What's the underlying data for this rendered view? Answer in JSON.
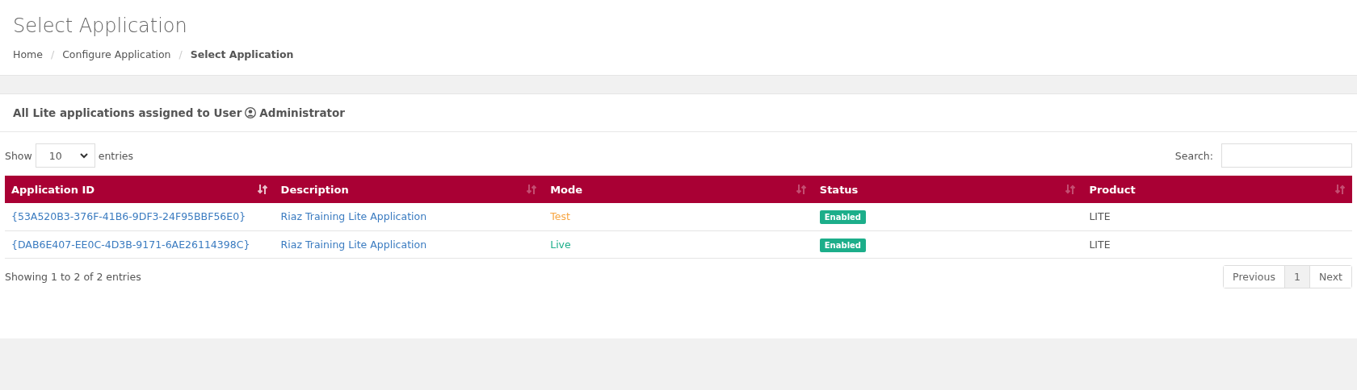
{
  "page_title": "Select Application",
  "breadcrumb": [
    {
      "label": "Home",
      "current": false
    },
    {
      "separator": "/",
      "label": "Configure Application",
      "current": false
    },
    {
      "separator": "/",
      "label": "Select Application",
      "current": true
    }
  ],
  "card": {
    "title_prefix": "All Lite applications assigned to User",
    "user": "Administrator"
  },
  "length_control": {
    "before": "Show",
    "value": "10",
    "after": "entries"
  },
  "search": {
    "label": "Search:"
  },
  "table": {
    "columns": [
      {
        "label": "Application ID",
        "sorted": true
      },
      {
        "label": "Description",
        "sorted": false
      },
      {
        "label": "Mode",
        "sorted": false
      },
      {
        "label": "Status",
        "sorted": false
      },
      {
        "label": "Product",
        "sorted": false
      }
    ],
    "rows": [
      {
        "id": "{53A520B3-376F-41B6-9DF3-24F95BBF56E0}",
        "description": "Riaz Training Lite Application",
        "mode": {
          "text": "Test",
          "color": "#f7a540"
        },
        "status": "Enabled",
        "product": "LITE"
      },
      {
        "id": "{DAB6E407-EE0C-4D3B-9171-6AE26114398C}",
        "description": "Riaz Training Lite Application",
        "mode": {
          "text": "Live",
          "color": "#1cae8a"
        },
        "status": "Enabled",
        "product": "LITE"
      }
    ]
  },
  "info": "Showing 1 to 2 of 2 entries",
  "pagination": [
    {
      "label": "Previous",
      "selected": false
    },
    {
      "label": "1",
      "selected": true
    },
    {
      "label": "Next",
      "selected": false
    }
  ]
}
